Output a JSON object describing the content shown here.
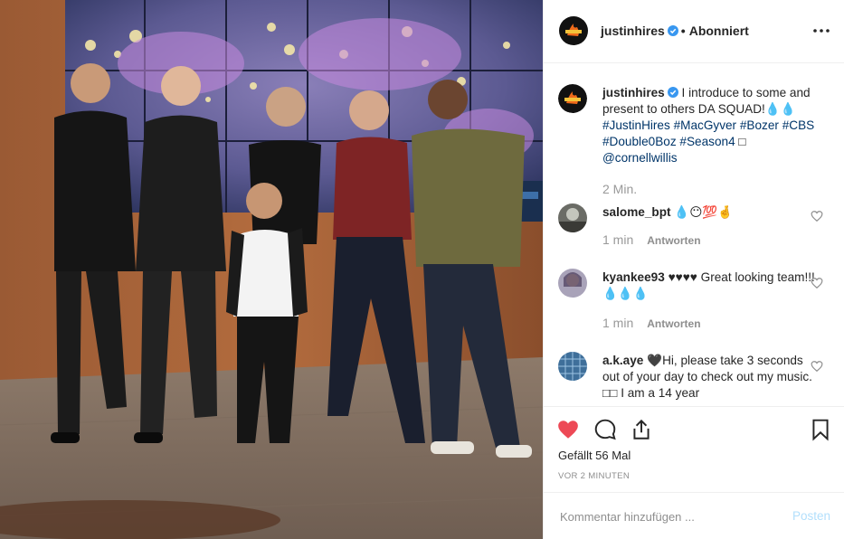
{
  "header": {
    "username": "justinhires",
    "separator": "•",
    "follow_state": "Abonniert",
    "avatar_icon": "flame-logo-icon",
    "verified_icon": "verified-badge-icon",
    "more_icon": "more-options-icon"
  },
  "caption": {
    "username": "justinhires",
    "text": "I introduce to some and present to others DA SQUAD!💧💧",
    "hashtags": [
      "#JustinHires",
      "#MacGyver",
      "#Bozer",
      "#CBS",
      "#Double0Boz",
      "#Season4",
      "□"
    ],
    "mention": "@cornellwillis",
    "time": "2 Min."
  },
  "comments": [
    {
      "username": "salome_bpt",
      "text": "💧😶💯🤞",
      "time": "1 min",
      "reply": "Antworten"
    },
    {
      "username": "kyankee93",
      "text": "♥♥♥♥ Great looking team!!! 💧💧💧",
      "time": "1 min",
      "reply": "Antworten"
    },
    {
      "username": "a.k.aye",
      "text": "🖤Hi, please take 3 seconds out of your day to check out my music. □□ I am a 14 year",
      "time": "",
      "reply": ""
    }
  ],
  "actions": {
    "liked": true,
    "like_color": "#ed4956",
    "likes_label": "Gefällt 56 Mal",
    "time_ago": "VOR 2 MINUTEN"
  },
  "composer": {
    "placeholder": "Kommentar hinzufügen ...",
    "post_label": "Posten",
    "post_color": "#b2dffc"
  },
  "colors": {
    "link": "#003569",
    "muted": "#8e8e8e",
    "verified": "#3897f0"
  }
}
